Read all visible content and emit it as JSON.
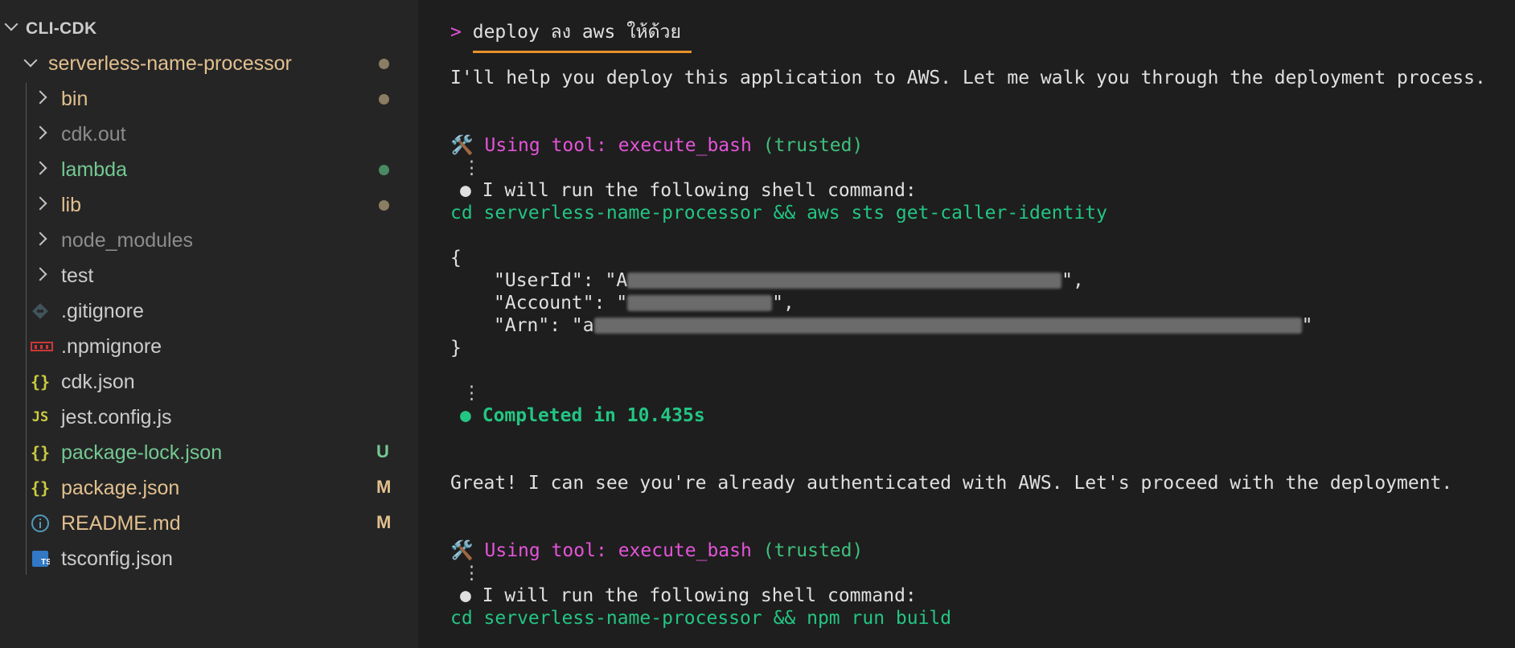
{
  "explorer": {
    "root_label": "CLI-CDK",
    "project_folder": "serverless-name-processor",
    "items": [
      {
        "label": "bin",
        "type": "folder"
      },
      {
        "label": "cdk.out",
        "type": "folder"
      },
      {
        "label": "lambda",
        "type": "folder"
      },
      {
        "label": "lib",
        "type": "folder"
      },
      {
        "label": "node_modules",
        "type": "folder"
      },
      {
        "label": "test",
        "type": "folder"
      },
      {
        "label": ".gitignore",
        "type": "file",
        "icon": "git-icon"
      },
      {
        "label": ".npmignore",
        "type": "file",
        "icon": "npm-icon"
      },
      {
        "label": "cdk.json",
        "type": "file",
        "icon": "json-icon",
        "icon_text": "{}"
      },
      {
        "label": "jest.config.js",
        "type": "file",
        "icon": "js-icon",
        "icon_text": "JS"
      },
      {
        "label": "package-lock.json",
        "type": "file",
        "icon": "json-icon",
        "icon_text": "{}",
        "badge": "U"
      },
      {
        "label": "package.json",
        "type": "file",
        "icon": "json-icon",
        "icon_text": "{}",
        "badge": "M"
      },
      {
        "label": "README.md",
        "type": "file",
        "icon": "info-icon",
        "icon_text": "i",
        "badge": "M"
      },
      {
        "label": "tsconfig.json",
        "type": "file",
        "icon": "ts-icon",
        "icon_text": "TS"
      }
    ],
    "colors": {
      "modified": "#e2c08d",
      "untracked": "#73c991",
      "ignored": "#8c8c8c",
      "default": "#cccccc"
    }
  },
  "terminal": {
    "prompt_symbol": ">",
    "prompt_text": "deploy ลง aws ให้ด้วย",
    "intro": "I'll help you deploy this application to AWS. Let me walk you through the deployment process.",
    "tool_calls": [
      {
        "icon": "🛠️",
        "using_tool_label": "Using tool:",
        "tool_name": "execute_bash",
        "trust": "(trusted)",
        "vdots": "⋮",
        "bullet": "●",
        "intent": "I will run the following shell command:",
        "command": "cd serverless-name-processor && aws sts get-caller-identity"
      },
      {
        "icon": "🛠️",
        "using_tool_label": "Using tool:",
        "tool_name": "execute_bash",
        "trust": "(trusted)",
        "vdots": "⋮",
        "bullet": "●",
        "intent": "I will run the following shell command:",
        "command": "cd serverless-name-processor && npm run build"
      }
    ],
    "json_output": {
      "open": "{",
      "userid_key": "\"UserId\": \"A",
      "userid_tail": "\",",
      "account_key": "\"Account\": \"",
      "account_tail": "\",",
      "arn_key": "\"Arn\": \"a",
      "arn_tail": "\"",
      "close": "}"
    },
    "vdots_after": "⋮",
    "completed_bullet": "●",
    "completed": "Completed in 10.435s",
    "followup": "Great! I can see you're already authenticated with AWS. Let's proceed with the deployment."
  }
}
